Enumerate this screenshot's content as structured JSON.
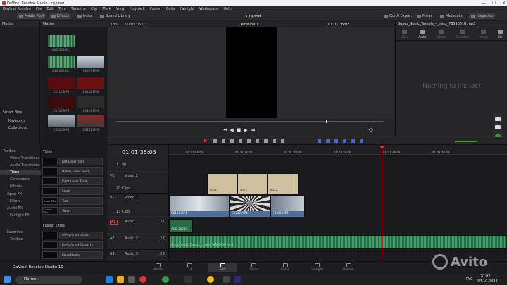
{
  "window": {
    "title": "DaVinci Resolve Studio - гудини",
    "min": "—",
    "max": "☐",
    "close": "✕"
  },
  "menu": [
    "DaVinci Resolve",
    "File",
    "Edit",
    "Trim",
    "Timeline",
    "Clip",
    "Mark",
    "View",
    "Playback",
    "Fusion",
    "Color",
    "Fairlight",
    "Workspace",
    "Help"
  ],
  "toolbar": {
    "media_pool": "Media Pool",
    "effects": "Effects",
    "index": "Index",
    "sound_library": "Sound Library",
    "project": "гудини",
    "quick_export": "Quick Export",
    "mixer": "Mixer",
    "metadata": "Metadata",
    "inspector": "Inspector"
  },
  "mediapool": {
    "left_header": "Master",
    "master": "Master",
    "smart_bins": "Smart Bins",
    "smart_items": [
      "Keywords",
      "Collections"
    ],
    "clips": [
      "AUD-20240...",
      "AUD-20240...",
      "AUD-20240...",
      "C0037.MP4",
      "C0115.MP4",
      "C0152.MP4",
      "C0155.MP4",
      "C0197.MP4",
      "C0200.MP4",
      "C0233.MP4"
    ]
  },
  "viewer": {
    "zoom": "18%",
    "src_tc": "00:02:05:03",
    "timeline_name": "Timeline 1",
    "tc": "01:01:35:05"
  },
  "inspector": {
    "file": "Super_Sonic_Temple_-_Intro_76596518.mp3",
    "tabs": [
      "Video",
      "Audio",
      "Effects",
      "Transition",
      "Image",
      "File"
    ],
    "empty": "Nothing to inspect"
  },
  "effects": {
    "categories": [
      "Toolbox",
      "Video Transitions",
      "Audio Transitions",
      "Titles",
      "Generators",
      "Effects",
      "Open FX",
      "Filters",
      "Audio FX",
      "Fairlight FX",
      "Favorites",
      "Toolbox"
    ],
    "titles_header": "Titles",
    "titles": [
      {
        "sw": "",
        "label": "Left Lower Third"
      },
      {
        "sw": "",
        "label": "Middle Lower Third"
      },
      {
        "sw": "",
        "label": "Right Lower Third"
      },
      {
        "sw": "",
        "label": "Scroll"
      },
      {
        "sw": "Basic Title",
        "label": "Text"
      },
      {
        "sw": "Custom Title",
        "label": "Text+"
      }
    ],
    "fusion_header": "Fusion Titles",
    "fusion": [
      "Background Reveal",
      "Background Reveal Lo...",
      "Black Border"
    ]
  },
  "timeline": {
    "tc": "01:01:35:05",
    "ruler": [
      "01:01:04:00",
      "01:01:12:00",
      "01:01:20:00",
      "01:01:28:00",
      "01:01:36:00",
      "01:01:44:00"
    ],
    "tracks": [
      {
        "id": "",
        "name": "",
        "count": "1 Clip"
      },
      {
        "id": "V2",
        "name": "Video 2",
        "count": "20 Clips"
      },
      {
        "id": "V1",
        "name": "Video 1",
        "count": "13 Clips"
      },
      {
        "id": "A1",
        "name": "Audio 1",
        "num": "2.0"
      },
      {
        "id": "A2",
        "name": "Audio 2",
        "num": "2.0"
      },
      {
        "id": "A3",
        "name": "Audio 3",
        "num": "2.0"
      }
    ],
    "clips": {
      "v1a": "C0197.MP4",
      "v1b": "C0232.MP4",
      "v1c": "C0037.MP4",
      "a1": "AUD-20240...",
      "a2": "Super_Sonic_Temple_-_Intro_76596518.mp3",
      "txt": "Text+"
    }
  },
  "pages": [
    "Media",
    "Cut",
    "Edit",
    "Fusion",
    "Color",
    "Fairlight",
    "Deliver"
  ],
  "brand": "DaVinci Resolve Studio 19",
  "taskbar": {
    "search": "Поиск",
    "lang": "РУС",
    "time": "20:02",
    "date": "04.10.2024"
  },
  "watermark": "Avito",
  "colors": {
    "accent": "#e03030",
    "video_clip": "#4d6f9a",
    "title_clip": "#cfc1a0",
    "audio_clip": "#2d6a4a"
  }
}
